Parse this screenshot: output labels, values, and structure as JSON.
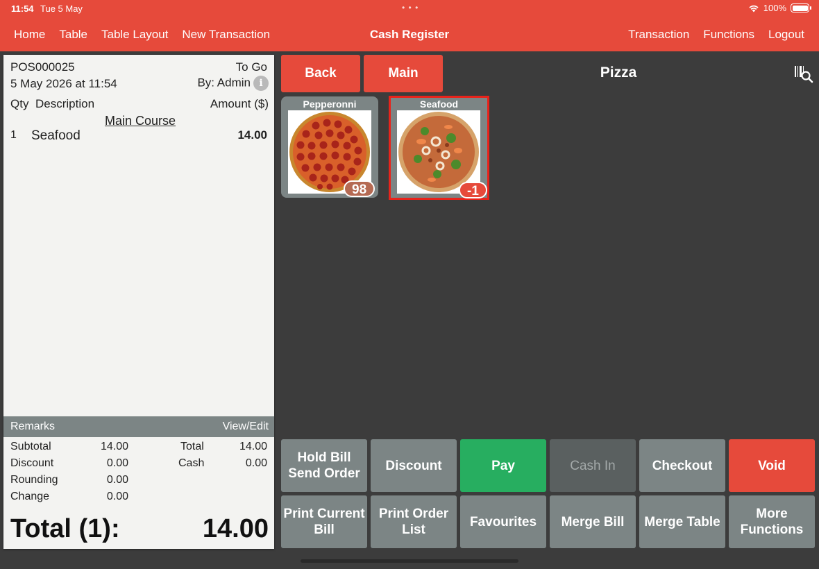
{
  "status": {
    "time": "11:54",
    "date": "Tue 5 May",
    "battery": "100%"
  },
  "nav": {
    "left": [
      "Home",
      "Table",
      "Table Layout",
      "New Transaction"
    ],
    "title": "Cash Register",
    "right": [
      "Transaction",
      "Functions",
      "Logout"
    ]
  },
  "receipt": {
    "order_no": "POS000025",
    "order_type": "To Go",
    "datetime": "5 May 2026 at 11:54",
    "by": "By: Admin",
    "col_qty": "Qty",
    "col_desc": "Description",
    "col_amount": "Amount ($)",
    "section": "Main Course",
    "lines": [
      {
        "qty": "1",
        "desc": "Seafood",
        "amount": "14.00"
      }
    ],
    "remarks_label": "Remarks",
    "remarks_action": "View/Edit",
    "subtotal_label": "Subtotal",
    "subtotal": "14.00",
    "discount_label": "Discount",
    "discount": "0.00",
    "rounding_label": "Rounding",
    "rounding": "0.00",
    "change_label": "Change",
    "change": "0.00",
    "total_label": "Total",
    "total": "14.00",
    "cash_label": "Cash",
    "cash": "0.00",
    "grand_label": "Total (1):",
    "grand_total": "14.00"
  },
  "menu": {
    "back": "Back",
    "main": "Main",
    "category": "Pizza",
    "items": [
      {
        "name": "Pepperonni",
        "stock": "98"
      },
      {
        "name": "Seafood",
        "stock": "-1"
      }
    ]
  },
  "functions": {
    "row1": [
      "Hold Bill\nSend Order",
      "Discount",
      "Pay",
      "Cash In",
      "Checkout",
      "Void"
    ],
    "row2": [
      "Print Current\nBill",
      "Print Order\nList",
      "Favourites",
      "Merge Bill",
      "Merge Table",
      "More\nFunctions"
    ]
  },
  "colors": {
    "accent": "#e64a3b",
    "panel": "#3c3c3c",
    "button": "#7c8585",
    "pay": "#27ae60"
  }
}
